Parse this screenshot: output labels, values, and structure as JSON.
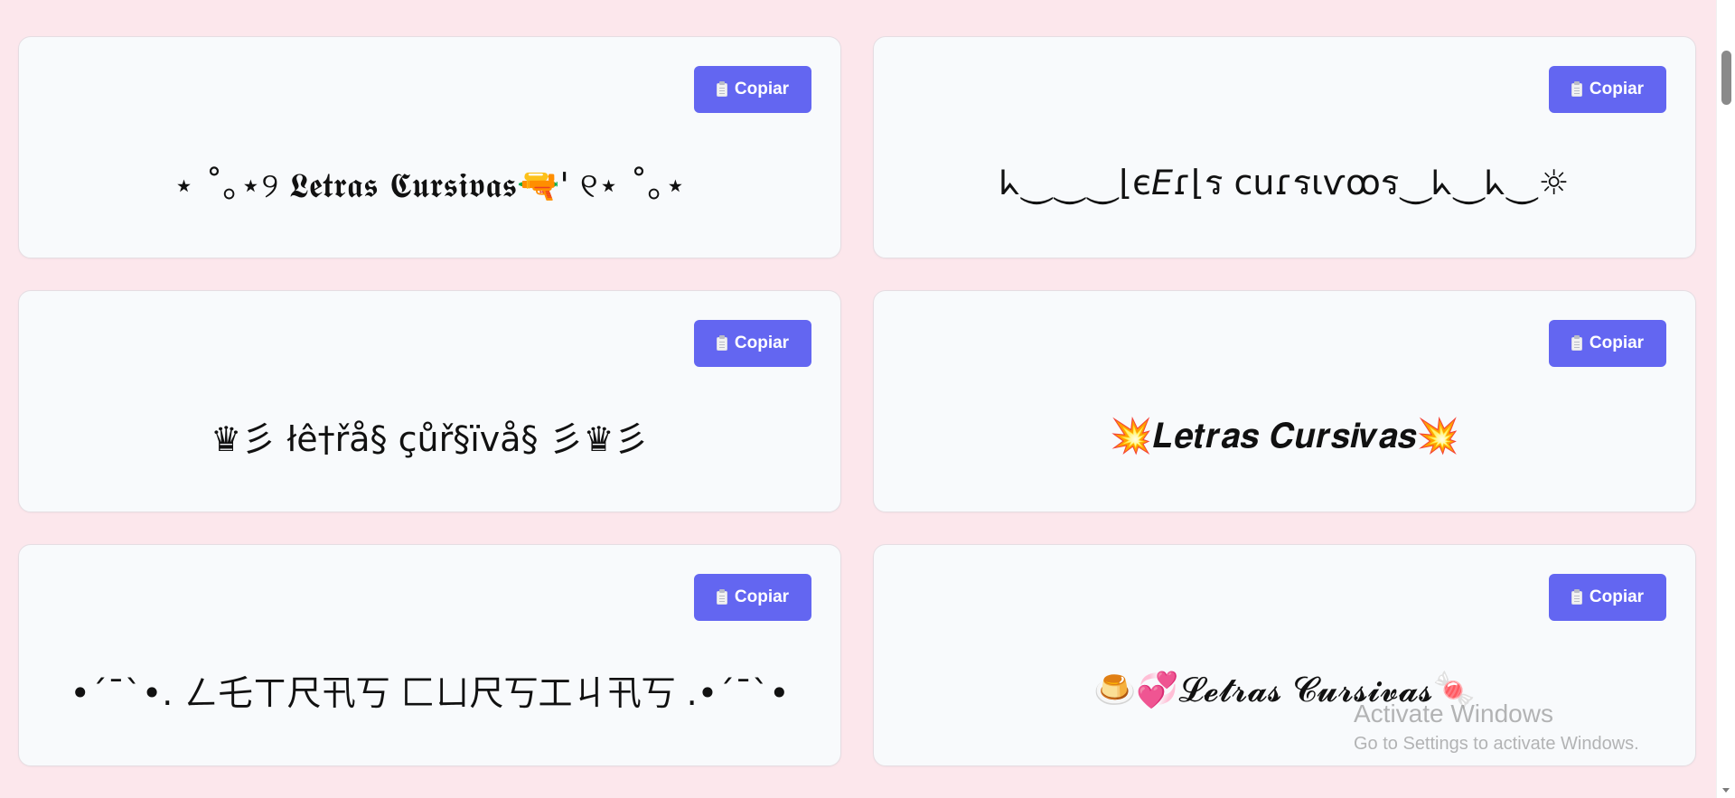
{
  "cards": [
    {
      "text": "⋆ ˚｡⋆୨ 𝕷𝖊𝖙𝖗𝖆𝖘 𝕮𝖚𝖗𝖘𝖎𝖛𝖆𝖘🔫' ୧⋆ ˚｡⋆",
      "button_label": "Copiar"
    },
    {
      "text": "ᖾ⏝⏝⏝⌊є𝘌ɾ⌊ร cuɾรιѵꝏร⏝ᖾ⏝ᖾ⏝☼",
      "button_label": "Copiar"
    },
    {
      "text": "♛彡 łê†řå§ çůř§ïvå§ 彡♛彡",
      "button_label": "Copiar"
    },
    {
      "text": "💥𝑳𝒆𝒕𝒓𝒂𝒔 𝑪𝒖𝒓𝒔𝒊𝒗𝒂𝒔💥",
      "button_label": "Copiar"
    },
    {
      "text": "•´¯`•. ㄥ乇ㄒ尺卂丂 匚ㄩ尺丂工ㄐ卂丂 .•´¯`•",
      "button_label": "Copiar"
    },
    {
      "text": "🍮💞𝓛𝓮𝓽𝓻𝓪𝓼 𝓒𝓾𝓻𝓼𝓲𝓿𝓪𝓼🍬",
      "button_label": "Copiar"
    }
  ],
  "watermark": {
    "title": "Activate Windows",
    "subtitle": "Go to Settings to activate Windows."
  },
  "colors": {
    "background": "#fce7ec",
    "card": "#f8fafc",
    "button": "#6366f1"
  }
}
